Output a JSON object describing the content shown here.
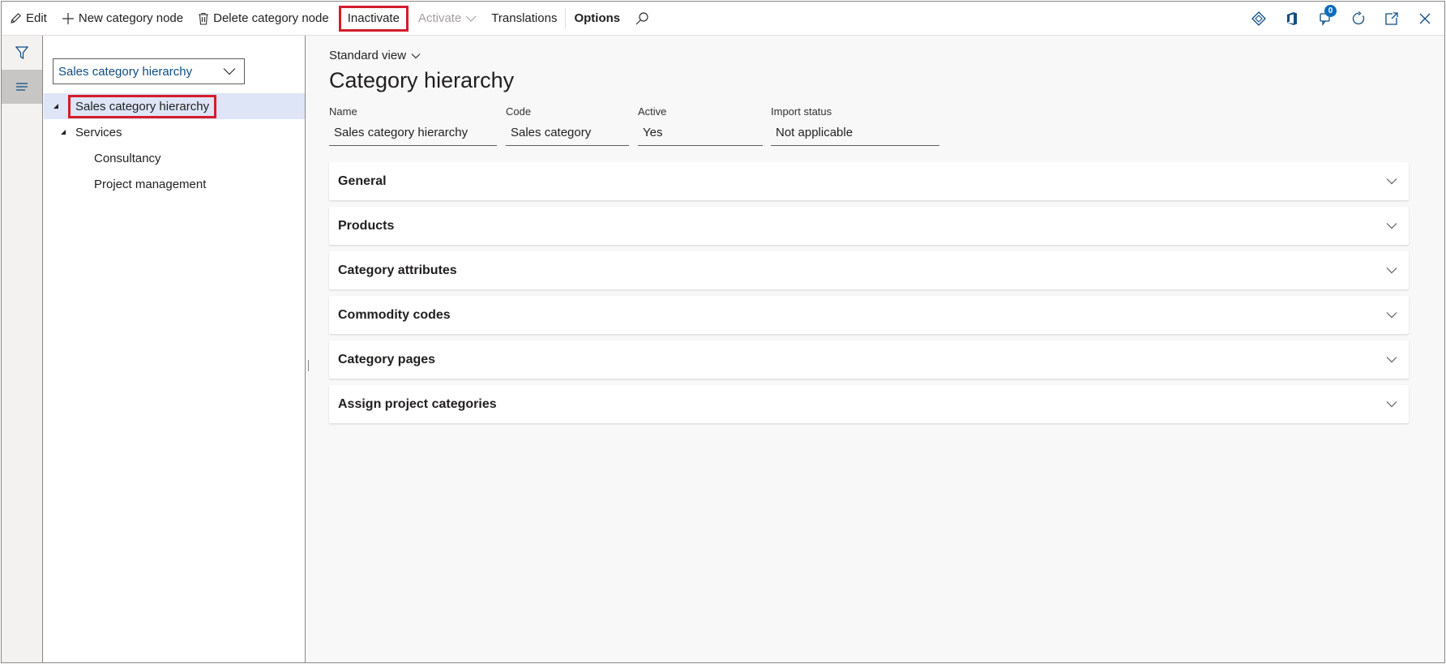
{
  "toolbar": {
    "edit": "Edit",
    "new_node": "New category node",
    "delete_node": "Delete category node",
    "inactivate": "Inactivate",
    "activate": "Activate",
    "translations": "Translations",
    "options": "Options",
    "right_icons": [
      "connected-apps-icon",
      "office-icon",
      "messages-icon",
      "refresh-icon",
      "open-new-window-icon",
      "close-icon"
    ],
    "notification_count": "0"
  },
  "rail": {
    "items": [
      "filter-icon",
      "list-icon"
    ]
  },
  "tree": {
    "hierarchy_select": "Sales category hierarchy",
    "nodes": [
      {
        "label": "Sales category hierarchy",
        "level": 0,
        "expanded": true,
        "selected": true
      },
      {
        "label": "Services",
        "level": 1,
        "expanded": true,
        "selected": false
      },
      {
        "label": "Consultancy",
        "level": 2,
        "expanded": false,
        "selected": false
      },
      {
        "label": "Project management",
        "level": 2,
        "expanded": false,
        "selected": false
      }
    ]
  },
  "main": {
    "view": "Standard view",
    "title": "Category hierarchy",
    "fields": {
      "name": {
        "label": "Name",
        "value": "Sales category hierarchy"
      },
      "code": {
        "label": "Code",
        "value": "Sales category"
      },
      "active": {
        "label": "Active",
        "value": "Yes"
      },
      "import_status": {
        "label": "Import status",
        "value": "Not applicable"
      }
    },
    "sections": [
      "General",
      "Products",
      "Category attributes",
      "Commodity codes",
      "Category pages",
      "Assign project categories"
    ]
  },
  "colors": {
    "highlight": "#d41c2c",
    "selected_row": "#dde5f7",
    "accent": "#0f6cbd"
  }
}
